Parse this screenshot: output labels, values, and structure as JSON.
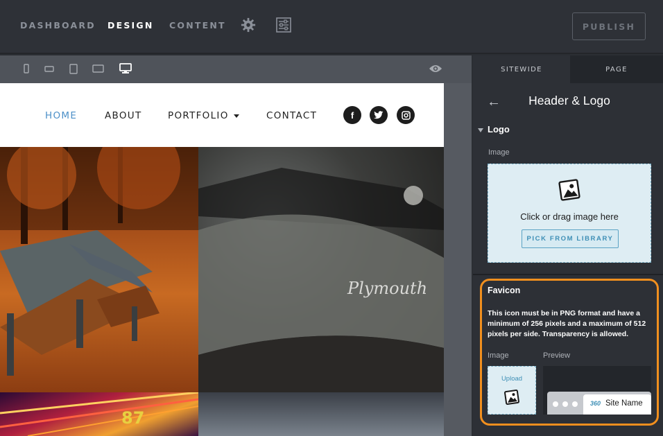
{
  "topnav": {
    "items": [
      "DASHBOARD",
      "DESIGN",
      "CONTENT"
    ],
    "active": "DESIGN",
    "publish_label": "PUBLISH",
    "icons": [
      "gear-icon",
      "panel-settings-icon"
    ]
  },
  "device_bar": {
    "devices": [
      "phone-portrait-icon",
      "phone-landscape-icon",
      "tablet-portrait-icon",
      "tablet-landscape-icon",
      "desktop-icon"
    ],
    "selected": "desktop-icon",
    "preview_icon": "eye-icon"
  },
  "site": {
    "menu": [
      "HOME",
      "ABOUT",
      "PORTFOLIO",
      "CONTACT"
    ],
    "active_menu": "HOME",
    "social": [
      {
        "name": "facebook-icon",
        "glyph": "f"
      },
      {
        "name": "twitter-icon",
        "glyph": "🐦"
      },
      {
        "name": "instagram-icon",
        "glyph": "◙"
      }
    ],
    "car_badge": "Plymouth",
    "lights_number": "87"
  },
  "panel": {
    "tabs": [
      "SITEWIDE",
      "PAGE"
    ],
    "active_tab": "SITEWIDE",
    "back_glyph": "←",
    "title": "Header & Logo",
    "logo_section": {
      "heading": "Logo",
      "image_label": "Image",
      "dropzone_text": "Click or drag image here",
      "pick_button": "PICK FROM LIBRARY"
    },
    "favicon": {
      "title": "Favicon",
      "description": "This icon must be in PNG format and have a minimum of 256 pixels and a maximum of 512 pixels per side. Transparency is allowed.",
      "image_label": "Image",
      "preview_label": "Preview",
      "upload_label": "Upload",
      "preview_site_name": "Site Name",
      "preview_logo": "360"
    }
  },
  "colors": {
    "accent": "#4c90c8",
    "highlight_ring": "#f18f1e",
    "dropzone_bg": "#deedf3"
  }
}
